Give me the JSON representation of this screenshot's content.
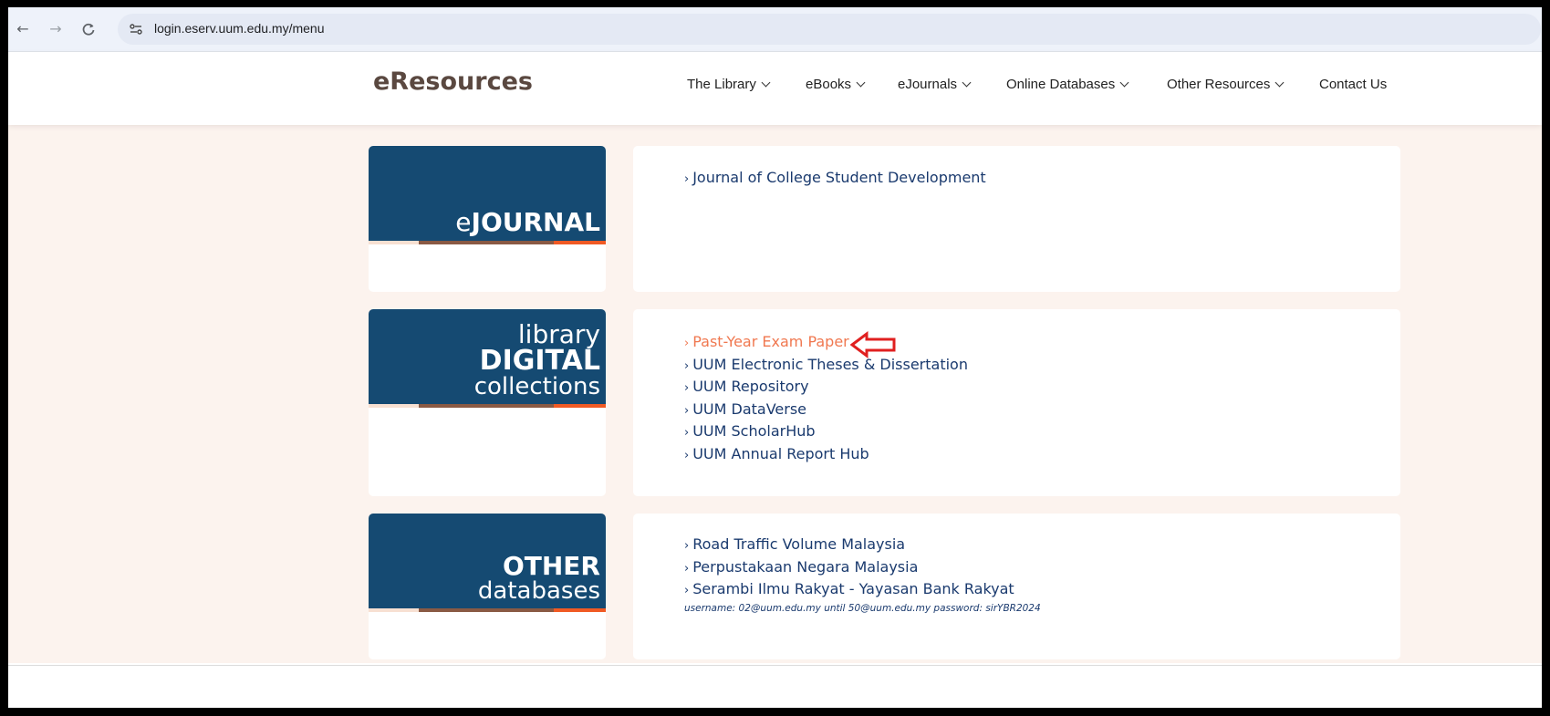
{
  "browser": {
    "url": "login.eserv.uum.edu.my/menu",
    "back_icon": "←",
    "forward_icon": "→",
    "reload_icon": "C",
    "site_settings_icon": "⚙"
  },
  "header": {
    "brand": "eResources",
    "menu": [
      {
        "label": "The Library"
      },
      {
        "label": "eBooks"
      },
      {
        "label": "eJournals"
      },
      {
        "label": "Online Databases"
      },
      {
        "label": "Other Resources"
      },
      {
        "label": "Contact Us"
      }
    ]
  },
  "sections": {
    "ejournal": {
      "banner": {
        "light": "e",
        "bold": "JOURNAL"
      },
      "links": [
        "Journal of College Student Development"
      ]
    },
    "digital": {
      "banner": {
        "line1": "library",
        "line2": "DIGITAL",
        "line3": "collections"
      },
      "links": [
        "Past-Year Exam Paper",
        "UUM Electronic Theses & Dissertation",
        "UUM Repository",
        "UUM DataVerse",
        "UUM ScholarHub",
        "UUM Annual Report Hub"
      ],
      "active_index": 0
    },
    "other": {
      "banner": {
        "line1": "OTHER",
        "line2": "databases"
      },
      "links": [
        "Road Traffic Volume Malaysia",
        "Perpustakaan Negara Malaysia",
        "Serambi Ilmu Rakyat - Yayasan Bank Rakyat"
      ],
      "note": "username: 02@uum.edu.my until 50@uum.edu.my password: sirYBR2024"
    }
  },
  "colors": {
    "banner": "#154a72",
    "link": "#1a3a6e",
    "active_link": "#f07850",
    "page_bg": "#fcf3ee",
    "annotation": "#e02020"
  }
}
